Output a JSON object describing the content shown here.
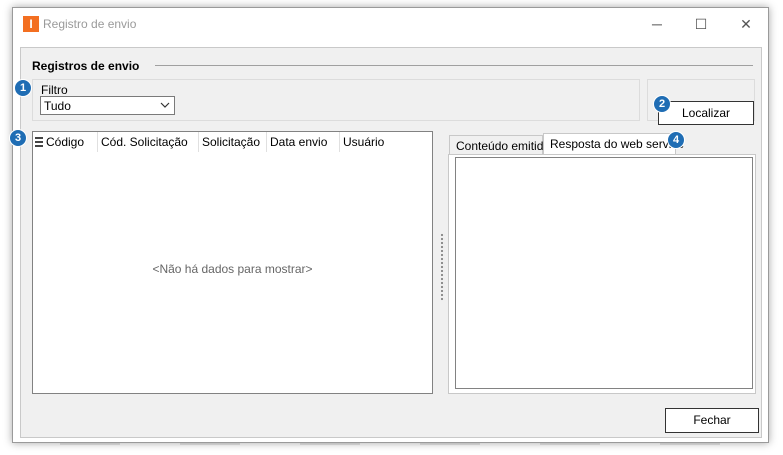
{
  "window": {
    "title": "Registro de envio",
    "app_icon_glyph": "I",
    "controls": {
      "minimize": "─",
      "maximize": "☐",
      "close": "✕"
    }
  },
  "group": {
    "label": "Registros de envio"
  },
  "filter": {
    "label": "Filtro",
    "value": "Tudo"
  },
  "buttons": {
    "locate": "Localizar",
    "close": "Fechar"
  },
  "grid": {
    "columns": [
      "Código",
      "Cód. Solicitação",
      "Solicitação",
      "Data envio",
      "Usuário"
    ],
    "empty_text": "<Não há dados para mostrar>"
  },
  "tabs": [
    {
      "label": "Conteúdo emitido",
      "active": false
    },
    {
      "label": "Resposta do web service",
      "active": true
    }
  ],
  "badges": [
    "1",
    "2",
    "3",
    "4"
  ],
  "colors": {
    "app_icon": "#f36f21",
    "badge": "#1f6db4"
  }
}
